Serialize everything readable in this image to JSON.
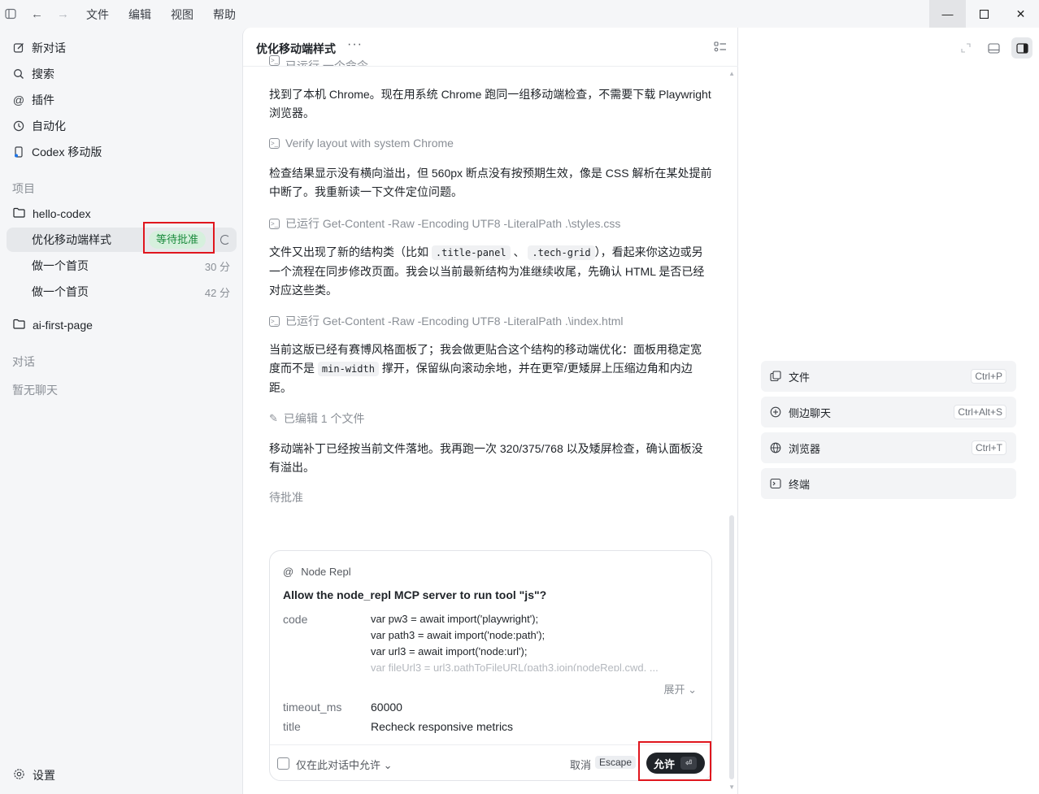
{
  "menu": [
    "文件",
    "编辑",
    "视图",
    "帮助"
  ],
  "sidebar": {
    "nav": [
      {
        "label": "新对话",
        "icon": "edit-icon"
      },
      {
        "label": "搜索",
        "icon": "search-icon"
      },
      {
        "label": "插件",
        "icon": "at-icon"
      },
      {
        "label": "自动化",
        "icon": "clock-icon"
      },
      {
        "label": "Codex 移动版",
        "icon": "mobile-icon"
      }
    ],
    "projects_label": "项目",
    "project1": "hello-codex",
    "threads": [
      {
        "title": "优化移动端样式",
        "badge": "等待批准"
      },
      {
        "title": "做一个首页",
        "time": "30 分"
      },
      {
        "title": "做一个首页",
        "time": "42 分"
      }
    ],
    "project2": "ai-first-page",
    "chats_label": "对话",
    "no_chats": "暂无聊天",
    "settings": "设置"
  },
  "main": {
    "title": "优化移动端样式",
    "more": "···",
    "top_partial": "已运行 一个命令",
    "p1": "找到了本机 Chrome。现在用系统 Chrome 跑同一组移动端检查，不需要下载 Playwright 浏览器。",
    "tool1": "Verify layout with system Chrome",
    "p2": "检查结果显示没有横向溢出，但 560px 断点没有按预期生效，像是 CSS 解析在某处提前中断了。我重新读一下文件定位问题。",
    "tool2": "已运行 Get-Content -Raw -Encoding UTF8 -LiteralPath .\\styles.css",
    "p3a": "文件又出现了新的结构类（比如",
    "p3code1": ".title-panel",
    "p3sep": "、",
    "p3code2": ".tech-grid",
    "p3b": "），看起来你这边或另一个流程在同步修改页面。我会以当前最新结构为准继续收尾，先确认 HTML 是否已经对应这些类。",
    "tool3": "已运行 Get-Content -Raw -Encoding UTF8 -LiteralPath .\\index.html",
    "p4a": "当前这版已经有赛博风格面板了；我会做更贴合这个结构的移动端优化：面板用稳定宽度而不是",
    "p4code": "min-width",
    "p4b": "撑开，保留纵向滚动余地，并在更窄/更矮屏上压缩边角和内边距。",
    "tool4": "已编辑 1 个文件",
    "p5": "移动端补丁已经按当前文件落地。我再跑一次 320/375/768 以及矮屏检查，确认面板没有溢出。",
    "pending": "待批准"
  },
  "card": {
    "source": "Node Repl",
    "question": "Allow the node_repl MCP server to run tool \"js\"?",
    "code_key": "code",
    "code_lines": [
      "var pw3 = await import('playwright');",
      "var path3 = await import('node:path');",
      "var url3 = await import('node:url');"
    ],
    "code_faded": "var fileUrl3 = url3.pathToFileURL(path3.join(nodeRepl.cwd, ...",
    "expand": "展开",
    "timeout_key": "timeout_ms",
    "timeout_val": "60000",
    "title_key": "title",
    "title_val": "Recheck responsive metrics",
    "only_this": "仅在此对话中允许",
    "cancel": "取消",
    "escape": "Escape",
    "allow": "允许"
  },
  "right": {
    "actions": [
      {
        "label": "文件",
        "shortcut": "Ctrl+P"
      },
      {
        "label": "侧边聊天",
        "shortcut": "Ctrl+Alt+S"
      },
      {
        "label": "浏览器",
        "shortcut": "Ctrl+T"
      },
      {
        "label": "终端",
        "shortcut": ""
      }
    ]
  }
}
